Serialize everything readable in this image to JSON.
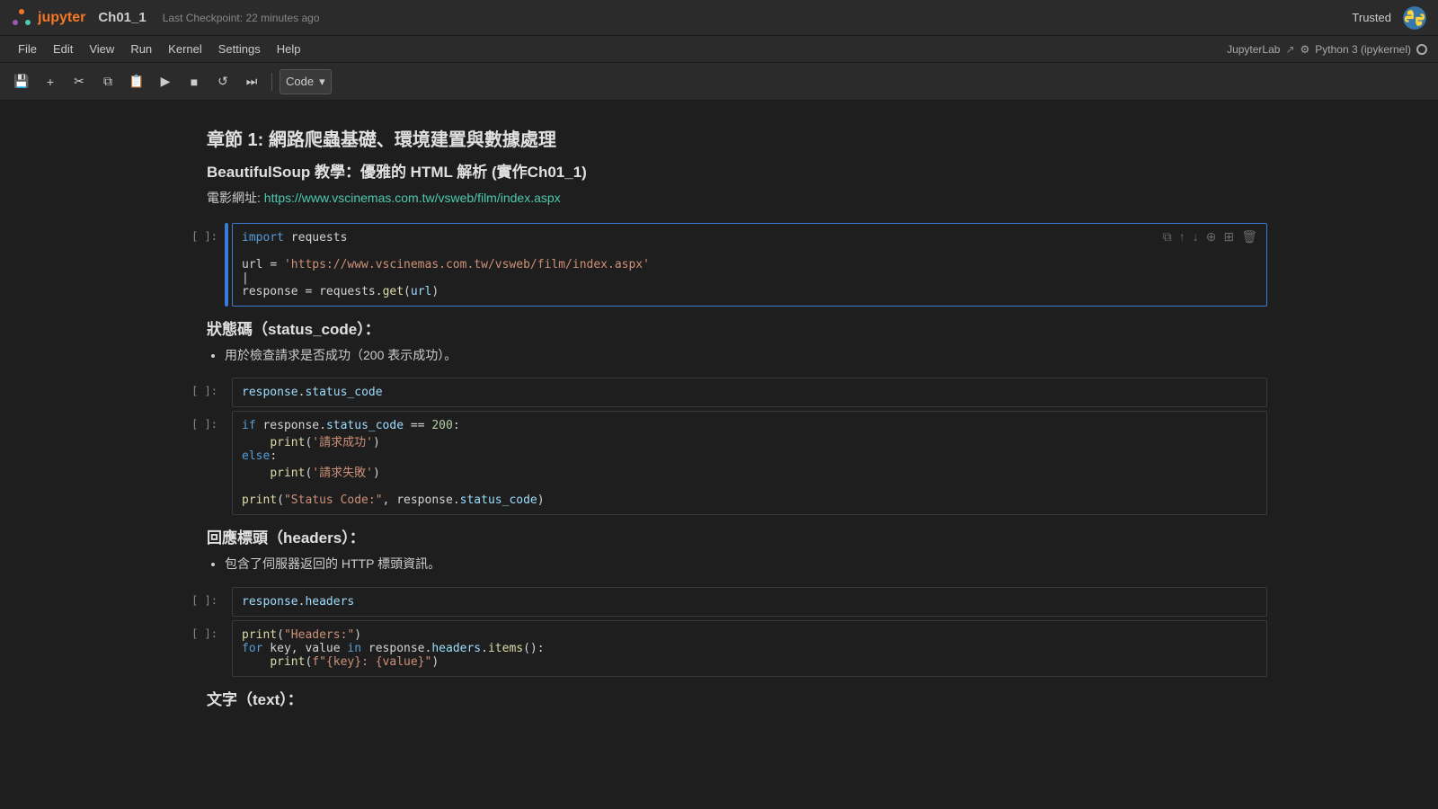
{
  "topbar": {
    "logo_text": "jupyter",
    "notebook_title": "Ch01_1",
    "checkpoint": "Last Checkpoint: 22 minutes ago",
    "trusted": "Trusted"
  },
  "menu": {
    "items": [
      "File",
      "Edit",
      "View",
      "Run",
      "Kernel",
      "Settings",
      "Help"
    ]
  },
  "toolbar": {
    "cell_type": "Code",
    "jupyterlab_label": "JupyterLab",
    "kernel_label": "Python 3 (ipykernel)"
  },
  "notebook": {
    "heading1": "章節 1: 網路爬蟲基礎、環境建置與數據處理",
    "heading2": "BeautifulSoup 教學：優雅的 HTML 解析 (實作Ch01_1)",
    "url_label": "電影網址:",
    "url_link": "https://www.vscinemas.com.tw/vsweb/film/index.aspx",
    "section1_title": "狀態碼（status_code）：",
    "section1_bullet": "用於檢查請求是否成功（200 表示成功）。",
    "section2_title": "回應標頭（headers）：",
    "section2_bullet": "包含了伺服器返回的 HTTP 標頭資訊。",
    "section3_title": "文字（text）："
  }
}
